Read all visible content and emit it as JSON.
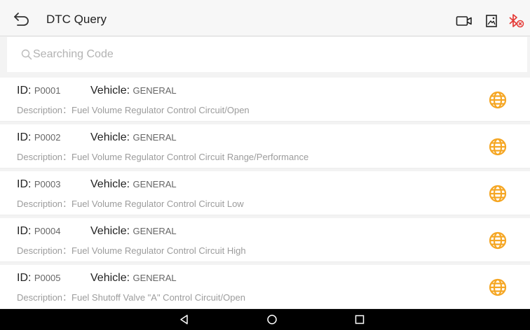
{
  "header": {
    "title": "DTC Query",
    "icons": [
      "back-arrow-icon",
      "video-record-icon",
      "screenshot-icon",
      "bluetooth-disconnected-icon"
    ],
    "bluetooth_color": "#e53935"
  },
  "search": {
    "placeholder": "Searching Code",
    "value": ""
  },
  "labels": {
    "id": "ID: ",
    "vehicle": "Vehicle: ",
    "description": "Description："
  },
  "accent_color": "#f5a623",
  "dtc_list": [
    {
      "id": "P0001",
      "vehicle": "GENERAL",
      "description": "Fuel Volume Regulator Control Circuit/Open"
    },
    {
      "id": "P0002",
      "vehicle": "GENERAL",
      "description": "Fuel Volume Regulator Control Circuit Range/Performance"
    },
    {
      "id": "P0003",
      "vehicle": "GENERAL",
      "description": "Fuel Volume Regulator Control Circuit Low"
    },
    {
      "id": "P0004",
      "vehicle": "GENERAL",
      "description": "Fuel Volume Regulator Control Circuit High"
    },
    {
      "id": "P0005",
      "vehicle": "GENERAL",
      "description": "Fuel Shutoff Valve \"A\" Control Circuit/Open"
    }
  ],
  "navbar": {
    "icons": [
      "nav-back-icon",
      "nav-home-icon",
      "nav-recents-icon"
    ]
  }
}
